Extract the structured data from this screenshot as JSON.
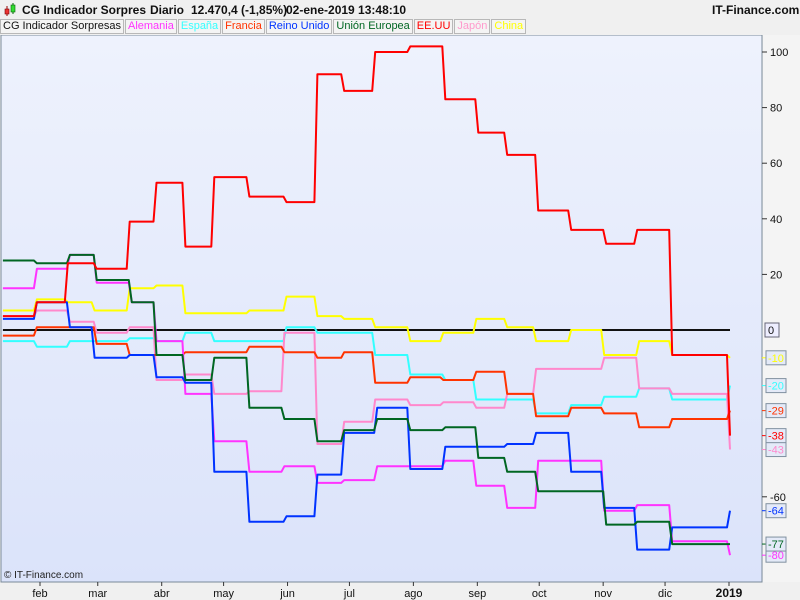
{
  "header": {
    "title": "CG Indicador Sorpres",
    "period": "Diario",
    "price": "12.470,4 (-1,85%)",
    "datetime": "02-ene-2019 13:48:10",
    "brand": "IT-Finance.com",
    "icon": "candlestick-icon"
  },
  "legend": [
    {
      "label": "CG Indicador Sorpresas",
      "color": "#111111"
    },
    {
      "label": "Alemania",
      "color": "#ff33ff"
    },
    {
      "label": "España",
      "color": "#33ffff"
    },
    {
      "label": "Francia",
      "color": "#ff3300"
    },
    {
      "label": "Reino Unido",
      "color": "#0033ff"
    },
    {
      "label": "Unión Europea",
      "color": "#006622"
    },
    {
      "label": "EE.UU",
      "color": "#ff0000"
    },
    {
      "label": "Japón",
      "color": "#ff99cc"
    },
    {
      "label": "China",
      "color": "#ffff00"
    }
  ],
  "watermark": "© IT-Finance.com",
  "chart_data": {
    "type": "line",
    "title": "CG Indicador Sorpresas",
    "x_unit": "day of year 2018",
    "xlim": [
      14,
      366
    ],
    "ylim": [
      -90,
      105
    ],
    "x_ticks": [
      {
        "label": "feb",
        "day": 32
      },
      {
        "label": "mar",
        "day": 60
      },
      {
        "label": "abr",
        "day": 91
      },
      {
        "label": "may",
        "day": 121
      },
      {
        "label": "jun",
        "day": 152
      },
      {
        "label": "jul",
        "day": 182
      },
      {
        "label": "ago",
        "day": 213
      },
      {
        "label": "sep",
        "day": 244
      },
      {
        "label": "oct",
        "day": 274
      },
      {
        "label": "nov",
        "day": 305
      },
      {
        "label": "dic",
        "day": 335
      },
      {
        "label": "2019",
        "day": 366,
        "bold": true
      }
    ],
    "y_ticks": [
      {
        "label": "100",
        "value": 100
      },
      {
        "label": "80",
        "value": 80
      },
      {
        "label": "60",
        "value": 60
      },
      {
        "label": "40",
        "value": 40
      },
      {
        "label": "20",
        "value": 20
      },
      {
        "label": "-60",
        "value": -60
      }
    ],
    "zero_label": "0",
    "series": [
      {
        "name": "Zero",
        "color": "#111111",
        "points": [
          [
            14,
            0
          ],
          [
            366,
            0
          ]
        ]
      },
      {
        "name": "China",
        "color": "#ffff00",
        "last_label": "-10",
        "points": [
          [
            14,
            7
          ],
          [
            30,
            11
          ],
          [
            45,
            10
          ],
          [
            58,
            7
          ],
          [
            75,
            15
          ],
          [
            88,
            16
          ],
          [
            102,
            6
          ],
          [
            133,
            7
          ],
          [
            151,
            12
          ],
          [
            166,
            5
          ],
          [
            179,
            4
          ],
          [
            194,
            1
          ],
          [
            211,
            -4
          ],
          [
            227,
            -1
          ],
          [
            243,
            4
          ],
          [
            258,
            1
          ],
          [
            272,
            -4
          ],
          [
            289,
            0
          ],
          [
            305,
            -9
          ],
          [
            322,
            -4
          ],
          [
            338,
            -9
          ],
          [
            366,
            -10
          ]
        ]
      },
      {
        "name": "España",
        "color": "#33ffff",
        "last_label": "-20",
        "points": [
          [
            14,
            -4
          ],
          [
            30,
            -6
          ],
          [
            46,
            -4
          ],
          [
            75,
            -3
          ],
          [
            88,
            -4
          ],
          [
            102,
            -1
          ],
          [
            116,
            -4
          ],
          [
            151,
            1
          ],
          [
            166,
            -1
          ],
          [
            194,
            -9
          ],
          [
            211,
            -16
          ],
          [
            228,
            -18
          ],
          [
            243,
            -25
          ],
          [
            272,
            -30
          ],
          [
            289,
            -27
          ],
          [
            305,
            -24
          ],
          [
            322,
            -21
          ],
          [
            338,
            -25
          ],
          [
            366,
            -20
          ]
        ]
      },
      {
        "name": "Japón",
        "color": "#ff88cc",
        "last_label": "-43",
        "points": [
          [
            14,
            5
          ],
          [
            30,
            7
          ],
          [
            46,
            3
          ],
          [
            59,
            -1
          ],
          [
            75,
            1
          ],
          [
            88,
            -18
          ],
          [
            102,
            -16
          ],
          [
            116,
            -23
          ],
          [
            133,
            -22
          ],
          [
            150,
            -1
          ],
          [
            166,
            -41
          ],
          [
            179,
            -33
          ],
          [
            194,
            -25
          ],
          [
            211,
            -27
          ],
          [
            227,
            -26
          ],
          [
            243,
            -28
          ],
          [
            258,
            -23
          ],
          [
            272,
            -14
          ],
          [
            289,
            -14
          ],
          [
            305,
            -10
          ],
          [
            322,
            -21
          ],
          [
            338,
            -23
          ],
          [
            366,
            -43
          ]
        ]
      },
      {
        "name": "Francia",
        "color": "#ff3300",
        "last_label": "-29",
        "points": [
          [
            14,
            -2
          ],
          [
            30,
            1
          ],
          [
            46,
            1
          ],
          [
            59,
            -5
          ],
          [
            75,
            -9
          ],
          [
            88,
            -9
          ],
          [
            102,
            -8
          ],
          [
            116,
            -8
          ],
          [
            133,
            -6
          ],
          [
            150,
            -8
          ],
          [
            166,
            -10
          ],
          [
            179,
            -8
          ],
          [
            194,
            -19
          ],
          [
            211,
            -17
          ],
          [
            227,
            -18
          ],
          [
            243,
            -15
          ],
          [
            258,
            -23
          ],
          [
            272,
            -31
          ],
          [
            289,
            -28
          ],
          [
            305,
            -30
          ],
          [
            322,
            -35
          ],
          [
            338,
            -32
          ],
          [
            366,
            -29
          ]
        ]
      },
      {
        "name": "Alemania",
        "color": "#ff33ff",
        "last_label": "-80",
        "points": [
          [
            14,
            15
          ],
          [
            30,
            22
          ],
          [
            46,
            27
          ],
          [
            59,
            17
          ],
          [
            76,
            10
          ],
          [
            88,
            -4
          ],
          [
            102,
            -23
          ],
          [
            116,
            -40
          ],
          [
            133,
            -51
          ],
          [
            150,
            -49
          ],
          [
            166,
            -55
          ],
          [
            179,
            -54
          ],
          [
            195,
            -49
          ],
          [
            228,
            -47
          ],
          [
            243,
            -56
          ],
          [
            258,
            -64
          ],
          [
            273,
            -47
          ],
          [
            305,
            -65
          ],
          [
            321,
            -63
          ],
          [
            338,
            -76
          ],
          [
            366,
            -81
          ]
        ]
      },
      {
        "name": "Reino Unido",
        "color": "#0033ff",
        "last_label": "-64",
        "points": [
          [
            14,
            4
          ],
          [
            30,
            10
          ],
          [
            46,
            1
          ],
          [
            58,
            -10
          ],
          [
            75,
            -9
          ],
          [
            88,
            -17
          ],
          [
            102,
            -19
          ],
          [
            116,
            -51
          ],
          [
            133,
            -69
          ],
          [
            151,
            -67
          ],
          [
            166,
            -52
          ],
          [
            179,
            -37
          ],
          [
            195,
            -28
          ],
          [
            211,
            -50
          ],
          [
            228,
            -42
          ],
          [
            258,
            -41
          ],
          [
            272,
            -37
          ],
          [
            289,
            -51
          ],
          [
            305,
            -64
          ],
          [
            321,
            -79
          ],
          [
            338,
            -71
          ],
          [
            366,
            -65
          ]
        ]
      },
      {
        "name": "Unión Europea",
        "color": "#006622",
        "last_label": "-77",
        "points": [
          [
            14,
            25
          ],
          [
            30,
            24
          ],
          [
            46,
            27
          ],
          [
            59,
            18
          ],
          [
            76,
            10
          ],
          [
            88,
            -9
          ],
          [
            102,
            -18
          ],
          [
            116,
            -10
          ],
          [
            133,
            -28
          ],
          [
            150,
            -32
          ],
          [
            166,
            -40
          ],
          [
            179,
            -36
          ],
          [
            195,
            -32
          ],
          [
            211,
            -36
          ],
          [
            228,
            -35
          ],
          [
            244,
            -46
          ],
          [
            258,
            -51
          ],
          [
            273,
            -58
          ],
          [
            289,
            -58
          ],
          [
            306,
            -70
          ],
          [
            321,
            -69
          ],
          [
            338,
            -77
          ],
          [
            366,
            -77
          ]
        ]
      },
      {
        "name": "EE.UU",
        "color": "#ff0000",
        "last_label": "-38",
        "points": [
          [
            14,
            5
          ],
          [
            30,
            10
          ],
          [
            45,
            24
          ],
          [
            59,
            22
          ],
          [
            75,
            39
          ],
          [
            88,
            53
          ],
          [
            102,
            30
          ],
          [
            116,
            55
          ],
          [
            133,
            48
          ],
          [
            151,
            46
          ],
          [
            166,
            92
          ],
          [
            179,
            86
          ],
          [
            194,
            100
          ],
          [
            211,
            102
          ],
          [
            228,
            83
          ],
          [
            244,
            71
          ],
          [
            258,
            63
          ],
          [
            273,
            43
          ],
          [
            289,
            36
          ],
          [
            306,
            31
          ],
          [
            321,
            36
          ],
          [
            338,
            -9
          ],
          [
            366,
            -38
          ]
        ]
      }
    ]
  }
}
